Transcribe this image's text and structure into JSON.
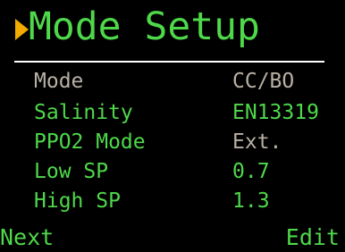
{
  "screen": {
    "title": "Mode Setup",
    "selection_indicator": "right-pointing-triangle-icon"
  },
  "settings": [
    {
      "label": "Mode",
      "value": "CC/BO",
      "state": "disabled"
    },
    {
      "label": "Salinity",
      "value": "EN13319",
      "state": "enabled"
    },
    {
      "label": "PPO2 Mode",
      "value": "Ext.",
      "state": "enabled-readonly"
    },
    {
      "label": "Low SP",
      "value": "0.7",
      "state": "enabled"
    },
    {
      "label": "High SP",
      "value": "1.3",
      "state": "enabled"
    }
  ],
  "softkeys": {
    "left": "Next",
    "right": "Edit"
  },
  "colors": {
    "background": "#000000",
    "active_text": "#4fd84a",
    "disabled_text": "#b7b0a4",
    "cursor": "#f2a900",
    "divider": "#ffffff"
  }
}
